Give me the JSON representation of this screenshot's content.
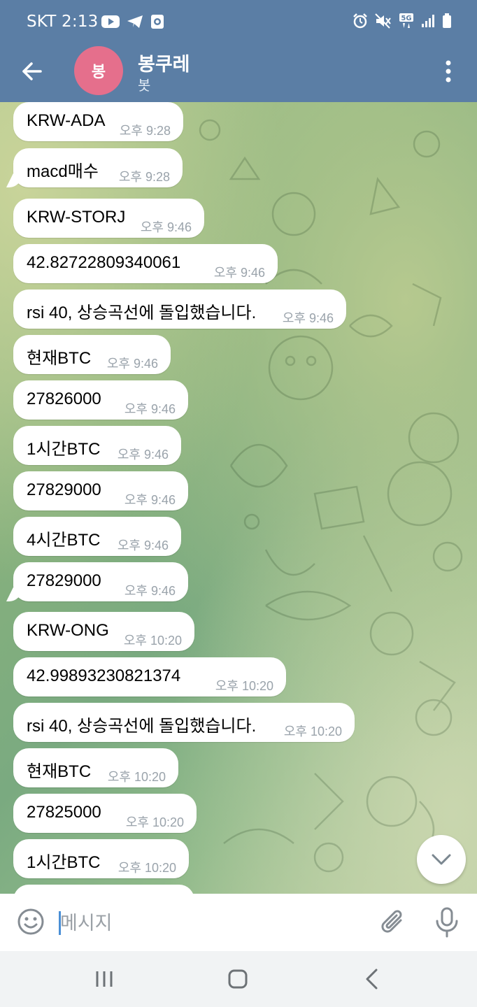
{
  "status_bar": {
    "time": "SKT 2:13",
    "left_icons": [
      "youtube-icon",
      "telegram-icon",
      "screen-record-icon"
    ],
    "right_icons": [
      "alarm-icon",
      "mute-icon",
      "5g-icon",
      "signal-icon",
      "battery-icon"
    ]
  },
  "header": {
    "avatar_text": "봉",
    "avatar_color": "#e56f8c",
    "title": "봉쿠레",
    "subtitle": "봇",
    "bar_color": "#5b7ea5"
  },
  "messages": [
    {
      "text": "KRW-ADA",
      "time": "오후 9:28"
    },
    {
      "text": "macd매수",
      "time": "오후 9:28"
    },
    {
      "text": "KRW-STORJ",
      "time": "오후 9:46"
    },
    {
      "text": "42.82722809340061",
      "time": "오후 9:46"
    },
    {
      "text": "rsi 40, 상승곡선에 돌입했습니다.",
      "time": "오후 9:46"
    },
    {
      "text": "현재BTC",
      "time": "오후 9:46"
    },
    {
      "text": "27826000",
      "time": "오후 9:46"
    },
    {
      "text": "1시간BTC",
      "time": "오후 9:46"
    },
    {
      "text": "27829000",
      "time": "오후 9:46"
    },
    {
      "text": "4시간BTC",
      "time": "오후 9:46"
    },
    {
      "text": "27829000",
      "time": "오후 9:46"
    },
    {
      "text": "KRW-ONG",
      "time": "오후 10:20"
    },
    {
      "text": "42.99893230821374",
      "time": "오후 10:20"
    },
    {
      "text": "rsi 40, 상승곡선에 돌입했습니다.",
      "time": "오후 10:20"
    },
    {
      "text": "현재BTC",
      "time": "오후 10:20"
    },
    {
      "text": "27825000",
      "time": "오후 10:20"
    },
    {
      "text": "1시간BTC",
      "time": "오후 10:20"
    }
  ],
  "input": {
    "placeholder": "메시지"
  }
}
